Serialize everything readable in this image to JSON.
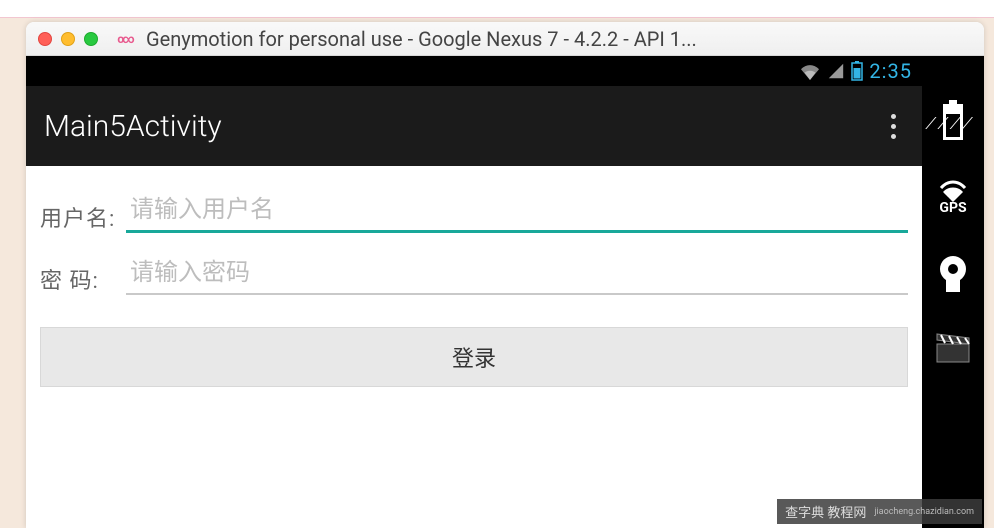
{
  "window": {
    "title": "Genymotion for personal use - Google Nexus 7 - 4.2.2 - API 1..."
  },
  "statusbar": {
    "time": "2:35"
  },
  "actionbar": {
    "title": "Main5Activity"
  },
  "form": {
    "username_label": "用户名:",
    "username_placeholder": "请输入用户名",
    "username_value": "",
    "password_label": "密  码:",
    "password_placeholder": "请输入密码",
    "password_value": "",
    "login_button": "登录"
  },
  "sidebar": {
    "gps_label": "GPS"
  },
  "watermark": {
    "cn": "查字典  教程网",
    "url": "jiaocheng.chazidian.com"
  }
}
